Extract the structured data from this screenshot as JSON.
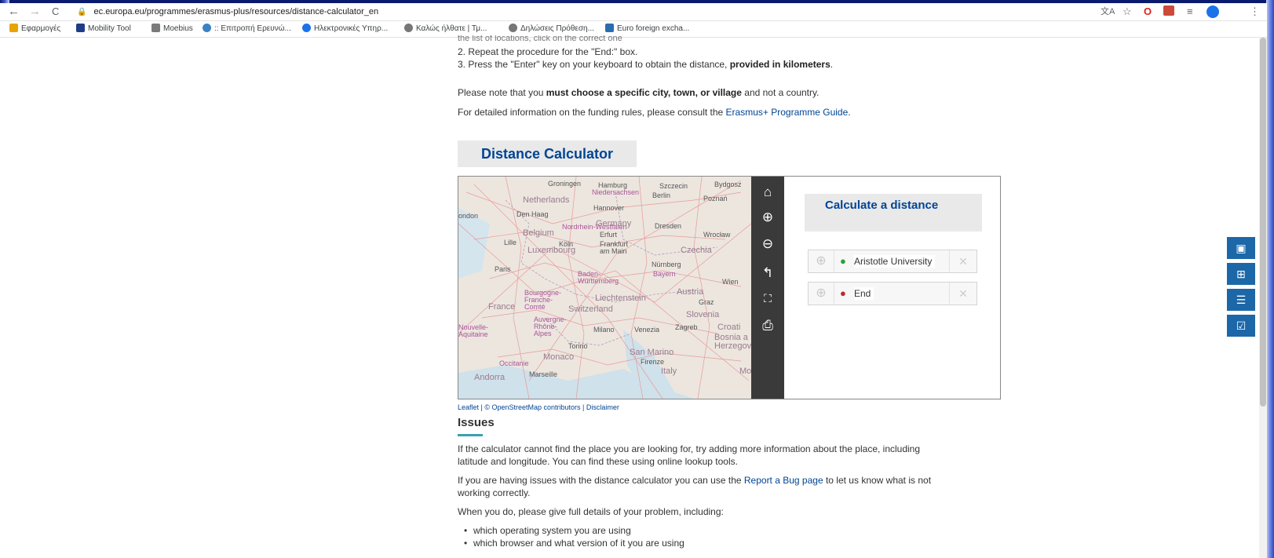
{
  "browser": {
    "url": "ec.europa.eu/programmes/erasmus-plus/resources/distance-calculator_en",
    "nav": {
      "back": "←",
      "forward": "→",
      "reload": "C"
    },
    "bookmarks": [
      {
        "label": "Εφαρμογές",
        "color": "#e8a400"
      },
      {
        "label": "Mobility Tool",
        "color": "#1f3c88"
      },
      {
        "label": "Moebius",
        "color": "#7a7a7a"
      },
      {
        "label": ":: Επιτροπή Ερευνώ...",
        "color": "#3b82c4"
      },
      {
        "label": "Ηλεκτρονικές Υπηρ...",
        "color": "#1a73e8"
      },
      {
        "label": "Καλώς ήλθατε | Τμ...",
        "color": "#777"
      },
      {
        "label": "Δηλώσεις Πρόθεση...",
        "color": "#777"
      },
      {
        "label": "Euro foreign excha...",
        "color": "#2b6cb0"
      }
    ]
  },
  "content": {
    "step1_tail": "the list of locations, click on the correct one",
    "step2": "2. Repeat the procedure for the \"End:\" box.",
    "step3_prefix": "3. Press the \"Enter\" key on your keyboard to obtain the distance, ",
    "step3_bold": "provided in kilometers",
    "step3_suffix": ".",
    "note_prefix": "Please note that you ",
    "note_bold": "must choose a specific city, town, or village",
    "note_suffix": " and not a country.",
    "funding_prefix": "For detailed information on the funding rules, please consult the ",
    "funding_link": "Erasmus+ Programme Guide",
    "funding_suffix": ".",
    "calculator_title": "Distance Calculator",
    "attribution": "Leaflet | © OpenStreetMap contributors | Disclaimer",
    "issues_title": "Issues",
    "issues_p1_line1": "If the calculator cannot find the place you are looking for, try adding more information about the place, including",
    "issues_p1_line2": "latitude and longitude. You can find these using online lookup tools.",
    "issues_p2_prefix": "If you are having issues with the distance calculator you can use the ",
    "issues_p2_link": "Report a Bug page",
    "issues_p2_suffix": " to let us know what is not",
    "issues_p2_line2": "working correctly.",
    "issues_p3": "When you do, please give full details of your problem, including:",
    "list": [
      "which operating system you are using",
      "which browser and what version of it you are using"
    ]
  },
  "calculator": {
    "heading": "Calculate a distance",
    "start_value": "Aristotle University",
    "end_placeholder": "End"
  },
  "map_labels": [
    "Groningen",
    "Hamburg",
    "Szczecin",
    "Bydgosz",
    "Niedersachsen",
    "Berlin",
    "Poznań",
    "Netherlands",
    "Hannover",
    "Den Haag",
    "ondon",
    "Nordrhein-Westfalen",
    "Germany",
    "Dresden",
    "Belgium",
    "Erfurt",
    "Wrocław",
    "Lille",
    "Köln",
    "Luxembourg",
    "Frankfurt am Main",
    "Czechia",
    "Paris",
    "Nürnberg",
    "Baden-Württemberg",
    "Bayern",
    "Wien",
    "Bourgogne-Franche-Comté",
    "Liechtenstein",
    "Austria",
    "France",
    "Switzerland",
    "Graz",
    "Slovenia",
    "Auvergne-Rhône-Alpes",
    "Nouvelle-Aquitaine",
    "Milano",
    "Venezia",
    "Zagreb",
    "Croati",
    "Torino",
    "Bosnia a Herzegov",
    "Monaco",
    "San Marino",
    "Firenze",
    "Occitanie",
    "Marseille",
    "Italy",
    "Andorra",
    "Mo"
  ],
  "colors": {
    "link": "#004494",
    "accent": "#3aa1b4",
    "tool": "#1c67a8",
    "start_pin": "#2e9e3a",
    "end_pin": "#c0282d"
  }
}
